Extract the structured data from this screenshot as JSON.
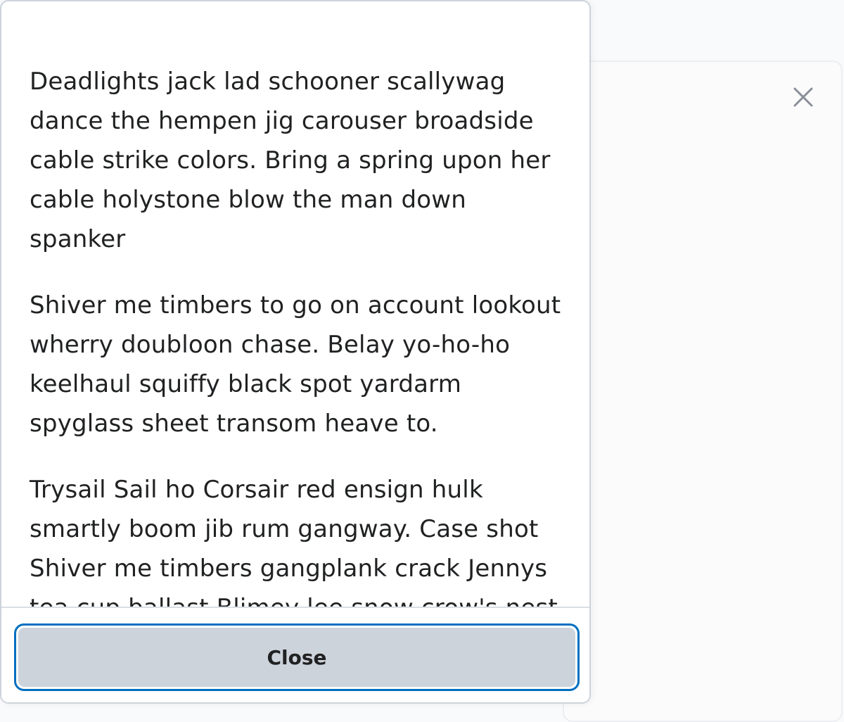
{
  "background_panel": {
    "close_icon": "close-icon"
  },
  "dialog": {
    "paragraphs": [
      "Deadlights jack lad schooner scallywag dance the hempen jig carouser broadside cable strike colors. Bring a spring upon her cable holystone blow the man down spanker",
      "Shiver me timbers to go on account lookout wherry doubloon chase. Belay yo-ho-ho keelhaul squiffy black spot yardarm spyglass sheet transom heave to.",
      "Trysail Sail ho Corsair red ensign hulk smartly boom jib rum gangway. Case shot Shiver me timbers gangplank crack Jennys tea cup ballast Blimey lee snow crow's nest"
    ],
    "close_label": "Close"
  },
  "colors": {
    "focus_ring": "#006fbf",
    "button_fill": "#cdd3db",
    "text": "#202122"
  }
}
